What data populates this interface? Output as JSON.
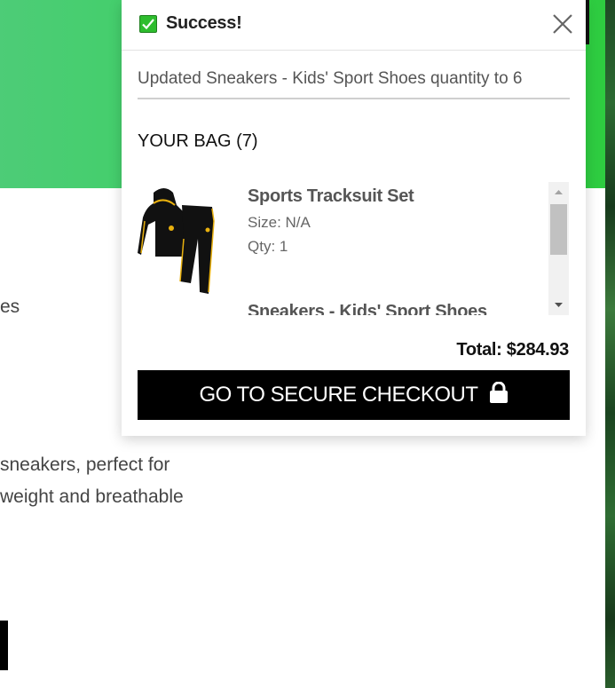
{
  "background": {
    "text_lines": [
      "es",
      "sneakers, perfect for",
      "weight and breathable"
    ]
  },
  "toast": {
    "title": "Success!",
    "message": "Updated Sneakers - Kids' Sport Shoes quantity to 6",
    "bag_heading": "YOUR BAG (7)",
    "items": [
      {
        "name": "Sports Tracksuit Set",
        "size": "Size: N/A",
        "qty": "Qty: 1"
      },
      {
        "name": "Sneakers - Kids' Sport Shoes",
        "size": "",
        "qty": ""
      }
    ],
    "total": "Total: $284.93",
    "checkout_label": "GO TO SECURE CHECKOUT"
  },
  "colors": {
    "accent_green": "#36d35a",
    "button_black": "#000000"
  },
  "icons": [
    "check-icon",
    "close-icon",
    "lock-icon",
    "scroll-up-icon",
    "scroll-down-icon"
  ]
}
